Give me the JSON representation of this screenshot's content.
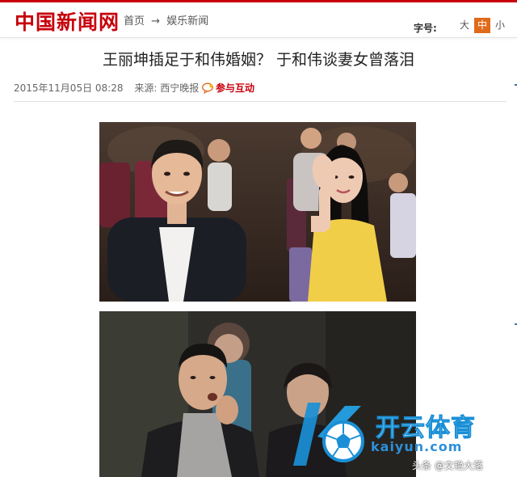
{
  "site": {
    "logo": "中国新闻网"
  },
  "breadcrumb": {
    "home": "首页",
    "arrow": "→",
    "section": "娱乐新闻"
  },
  "font_controls": {
    "label": "字号:",
    "large": "大",
    "medium": "中",
    "small": "小",
    "active": "中"
  },
  "article": {
    "title": "王丽坤插足于和伟婚姻？ 于和伟谈妻女曾落泪",
    "date": "2015年11月05日 08:28",
    "source_label": "来源:",
    "source": "西宁晚报",
    "interact": "参与互动"
  },
  "watermark": {
    "brand": "开云体育",
    "url": "kaiyun.com",
    "source": "头条 @文艳大落"
  },
  "colors": {
    "brand_red": "#c7000b",
    "active_orange": "#e06a1b",
    "watermark_blue": "#1a8fd6"
  }
}
